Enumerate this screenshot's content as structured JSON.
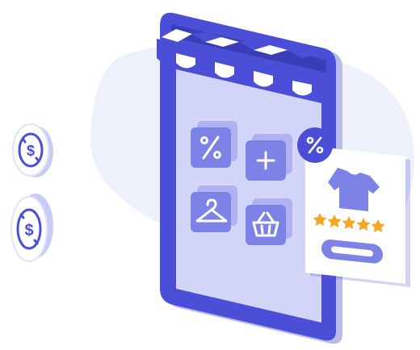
{
  "illustration": {
    "subject": "mobile-shop-app",
    "colors": {
      "primary": "#4B4FD8",
      "primary_dark": "#3A3DB8",
      "screen": "#C9CBF7",
      "tile": "#7C82E6",
      "tile_shadow": "#AEB2F0",
      "blob": "#EEF0FB",
      "card": "#FFFFFF",
      "star": "#F5A623",
      "coin_outline": "#C9CBF7"
    },
    "icons": [
      "discount-icon",
      "plus-icon",
      "hanger-icon",
      "basket-icon",
      "tshirt-icon",
      "percent-badge-icon",
      "dollar-coin-icon"
    ],
    "rating": {
      "stars": 5,
      "max": 5
    }
  }
}
